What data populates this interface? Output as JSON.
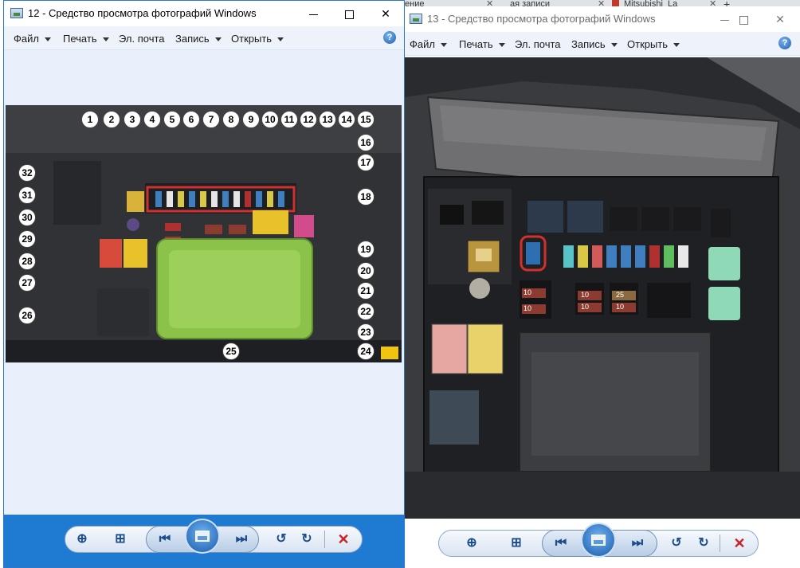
{
  "browser_tabs": {
    "tab1": "ение",
    "tab2": "ая записи",
    "tab3": "Mitsubishi_La",
    "new_tab": "+",
    "close": "✕"
  },
  "window12": {
    "title": "12 - Средство просмотра фотографий Windows",
    "menu": [
      "Файл",
      "Печать",
      "Эл. почта",
      "Запись",
      "Открыть"
    ],
    "help": "?",
    "callouts": [
      "1",
      "2",
      "3",
      "4",
      "5",
      "6",
      "7",
      "8",
      "9",
      "10",
      "11",
      "12",
      "13",
      "14",
      "15",
      "16",
      "17",
      "18",
      "19",
      "20",
      "21",
      "22",
      "23",
      "24",
      "25",
      "26",
      "27",
      "28",
      "29",
      "30",
      "31",
      "32"
    ]
  },
  "window13": {
    "title": "13 - Средство просмотра фотографий Windows",
    "menu": [
      "Файл",
      "Печать",
      "Эл. почта",
      "Запись",
      "Открыть"
    ],
    "help": "?",
    "fuse_labels": [
      "10",
      "10",
      "10",
      "10",
      "25",
      "10",
      "10"
    ]
  },
  "toolbar": {
    "zoom": "⊕",
    "actual_size": "⊞",
    "prev": "⏮",
    "next": "⏭",
    "rotate_ccw": "↺",
    "rotate_cw": "↻",
    "delete": "✕"
  },
  "colors": {
    "titlebar_border": "#2b79c8",
    "bottombar_blue": "#1f7ad2",
    "viewer_bg": "#eaf0fb",
    "fuse_box_green": "#8bc34a",
    "highlight_red": "#d0312d"
  }
}
